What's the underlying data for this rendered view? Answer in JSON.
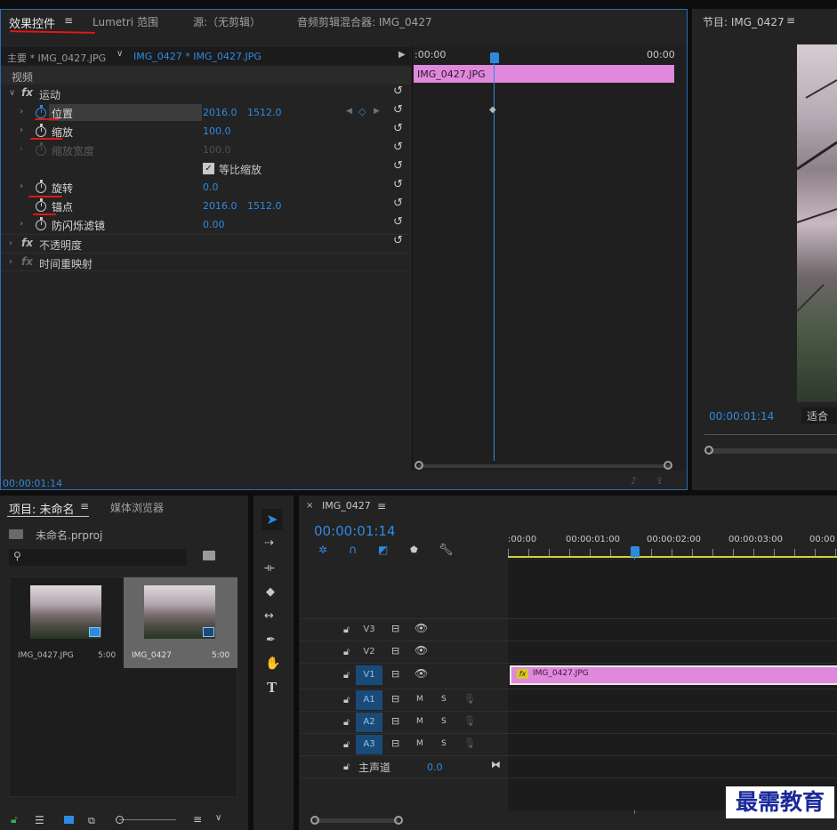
{
  "effect_controls": {
    "tabs": [
      "效果控件",
      "Lumetri 范围",
      "源:（无剪辑）",
      "音频剪辑混合器: IMG_0427"
    ],
    "master_clip": "主要 * IMG_0427.JPG",
    "sequence_clip": "IMG_0427 * IMG_0427.JPG",
    "video_header": "视频",
    "timeline_start": ":00:00",
    "timeline_end": "00:00",
    "clip_bar_label": "IMG_0427.JPG",
    "motion": "运动",
    "properties": [
      {
        "name": "位置",
        "v1": "2016.0",
        "v2": "1512.0"
      },
      {
        "name": "缩放",
        "v1": "100.0",
        "v2": ""
      },
      {
        "name": "缩放宽度",
        "v1": "100.0",
        "v2": ""
      },
      {
        "name": "旋转",
        "v1": "0.0",
        "v2": ""
      },
      {
        "name": "锚点",
        "v1": "2016.0",
        "v2": "1512.0"
      },
      {
        "name": "防闪烁滤镜",
        "v1": "0.00",
        "v2": ""
      }
    ],
    "uniform_scale": "等比缩放",
    "opacity": "不透明度",
    "time_remap": "时间重映射",
    "current_time": "00:00:01:14"
  },
  "program_monitor": {
    "title": "节目: IMG_0427",
    "timecode": "00:00:01:14",
    "fit": "适合"
  },
  "project_panel": {
    "tabs": [
      "项目: 未命名",
      "媒体浏览器"
    ],
    "project_file": "未命名.prproj",
    "items": [
      {
        "name": "IMG_0427.JPG",
        "duration": "5:00"
      },
      {
        "name": "IMG_0427",
        "duration": "5:00"
      }
    ]
  },
  "timeline": {
    "sequence_name": "IMG_0427",
    "timecode": "00:00:01:14",
    "ruler": [
      ":00:00",
      "00:00:01:00",
      "00:00:02:00",
      "00:00:03:00",
      "00:00"
    ],
    "video_tracks": [
      "V3",
      "V2",
      "V1"
    ],
    "audio_tracks": [
      "A1",
      "A2",
      "A3"
    ],
    "mute": "M",
    "solo": "S",
    "master_label": "主声道",
    "master_value": "0.0",
    "clip_label": "IMG_0427.JPG",
    "fx_badge": "fx"
  },
  "watermark": "最需教育",
  "colors": {
    "accent_blue": "#2e8ae0",
    "clip_pink": "#e088dc",
    "annotation_red": "#e01818"
  }
}
